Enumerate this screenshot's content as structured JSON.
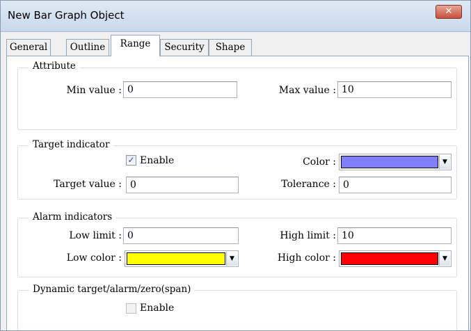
{
  "window": {
    "title": "New Bar Graph Object",
    "close_symbol": "✕"
  },
  "tabs": [
    {
      "label": "General"
    },
    {
      "label": "Outline"
    },
    {
      "label": "Range",
      "active": true
    },
    {
      "label": "Security"
    },
    {
      "label": "Shape"
    }
  ],
  "attribute": {
    "title": "Attribute",
    "min_label": "Min value :",
    "min_value": "0",
    "max_label": "Max value :",
    "max_value": "10"
  },
  "target": {
    "title": "Target indicator",
    "enable_label": "Enable",
    "enable_checked": true,
    "check_mark": "✓",
    "color_label": "Color :",
    "color": "#8080ff",
    "target_label": "Target value :",
    "target_value": "0",
    "tolerance_label": "Tolerance :",
    "tolerance_value": "0"
  },
  "alarm": {
    "title": "Alarm indicators",
    "low_label": "Low limit :",
    "low_value": "0",
    "high_label": "High limit :",
    "high_value": "10",
    "low_color_label": "Low color :",
    "low_color": "#ffff00",
    "high_color_label": "High color :",
    "high_color": "#ff0000"
  },
  "dynamic": {
    "title": "Dynamic target/alarm/zero(span)",
    "enable_label": "Enable",
    "enable_checked": false
  },
  "dropdown_arrow": "▼"
}
